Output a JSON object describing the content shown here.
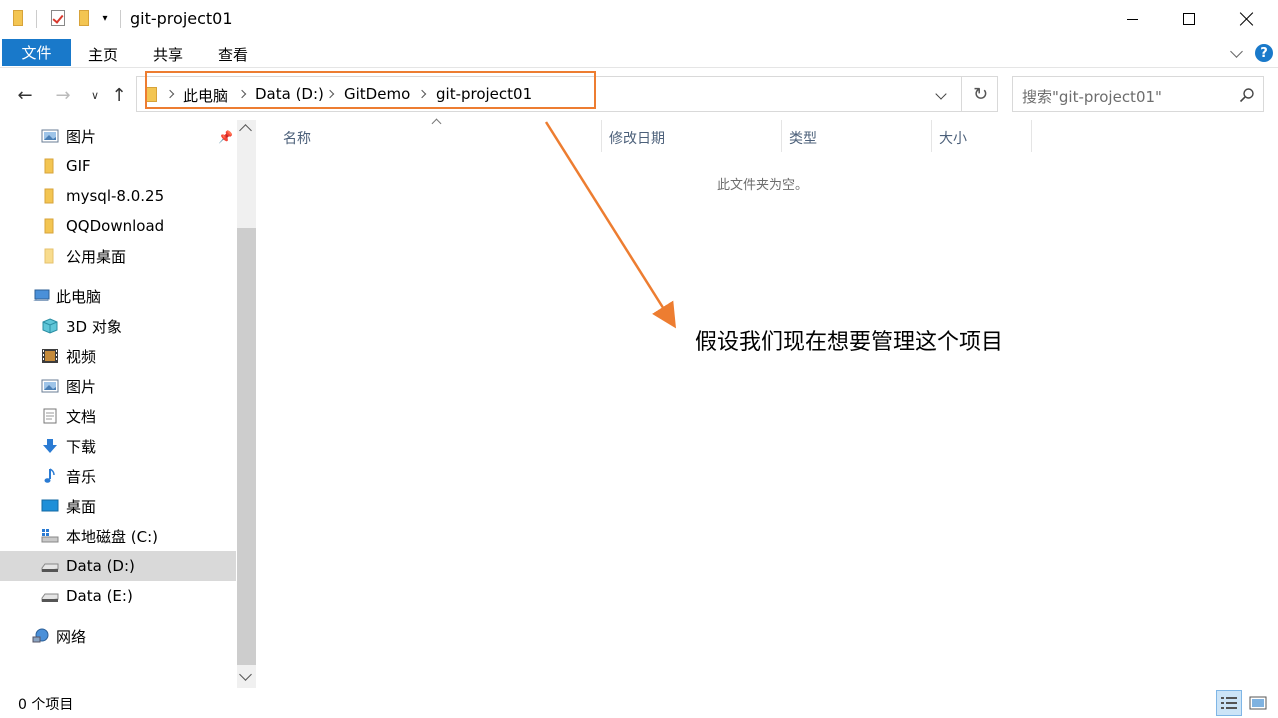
{
  "window": {
    "title": "git-project01"
  },
  "ribbon": {
    "tabs": [
      "文件",
      "主页",
      "共享",
      "查看"
    ],
    "help": "?"
  },
  "nav": {
    "breadcrumb": [
      "此电脑",
      "Data (D:)",
      "GitDemo",
      "git-project01"
    ],
    "search_placeholder": "搜索\"git-project01\""
  },
  "sidebar": {
    "items": [
      {
        "label": "图片",
        "icon": "pictures-icon",
        "pinned": true
      },
      {
        "label": "GIF",
        "icon": "folder-icon"
      },
      {
        "label": "mysql-8.0.25",
        "icon": "folder-icon"
      },
      {
        "label": "QQDownload",
        "icon": "folder-icon"
      },
      {
        "label": "公用桌面",
        "icon": "folder-icon"
      },
      {
        "label": "此电脑",
        "icon": "this-pc-icon"
      },
      {
        "label": "3D 对象",
        "icon": "3d-objects-icon"
      },
      {
        "label": "视频",
        "icon": "videos-icon"
      },
      {
        "label": "图片",
        "icon": "pictures-icon"
      },
      {
        "label": "文档",
        "icon": "documents-icon"
      },
      {
        "label": "下载",
        "icon": "downloads-icon"
      },
      {
        "label": "音乐",
        "icon": "music-icon"
      },
      {
        "label": "桌面",
        "icon": "desktop-icon"
      },
      {
        "label": "本地磁盘 (C:)",
        "icon": "windows-drive-icon"
      },
      {
        "label": "Data (D:)",
        "icon": "drive-icon",
        "selected": true
      },
      {
        "label": "Data (E:)",
        "icon": "drive-icon"
      },
      {
        "label": "网络",
        "icon": "network-icon"
      }
    ]
  },
  "content": {
    "columns": [
      "名称",
      "修改日期",
      "类型",
      "大小"
    ],
    "empty_message": "此文件夹为空。",
    "annotation": "假设我们现在想要管理这个项目"
  },
  "status": {
    "item_count": "0 个项目"
  },
  "colors": {
    "accent": "#1979ca",
    "highlight": "#ed7d31",
    "selected": "#d9d9d9"
  }
}
